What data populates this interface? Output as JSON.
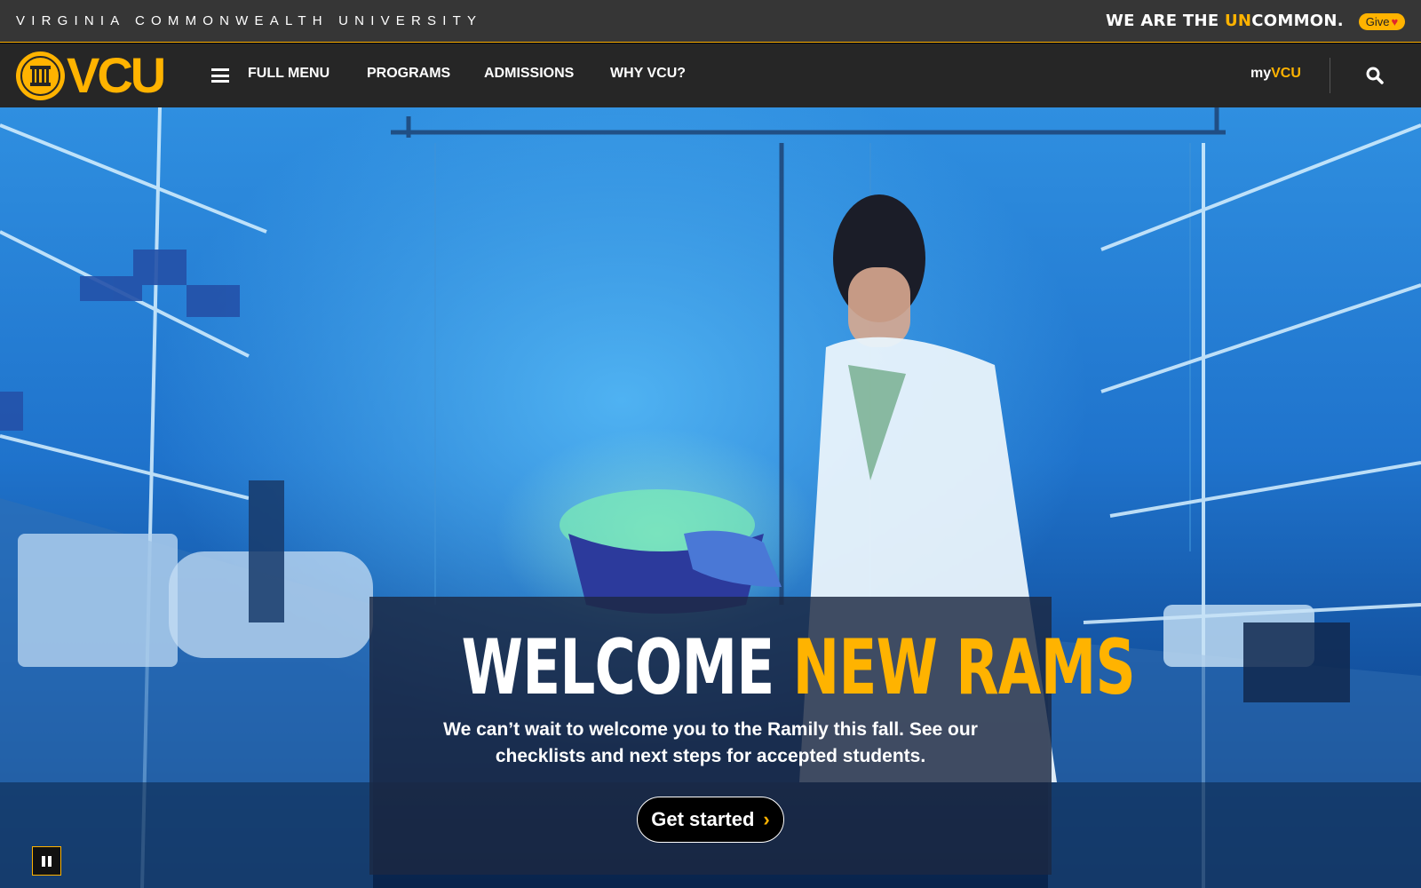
{
  "utility": {
    "university_name": "VIRGINIA COMMONWEALTH UNIVERSITY",
    "tagline_pre": "WE ARE THE ",
    "tagline_highlight": "UN",
    "tagline_post": "COMMON.",
    "give_label": "Give"
  },
  "nav": {
    "logo_text": "VCU",
    "full_menu": "FULL MENU",
    "programs": "PROGRAMS",
    "admissions": "ADMISSIONS",
    "why_vcu": "WHY VCU?",
    "myvcu_prefix": "my",
    "myvcu_accent": "VCU"
  },
  "hero": {
    "headline_white": "WELCOME ",
    "headline_gold": "NEW RAMS",
    "subtitle": "We can’t wait to welcome you to the Ramily this fall. See our checklists and next steps for accepted students.",
    "cta_label": "Get started",
    "video_paused": false
  },
  "colors": {
    "brand_gold": "#ffb300",
    "nav_bg": "#262626",
    "utility_bg": "#363636"
  },
  "icons": {
    "menu": "hamburger-icon",
    "search": "search-icon",
    "give": "heart-icon",
    "pause": "pause-icon",
    "cta": "chevron-right-icon"
  }
}
